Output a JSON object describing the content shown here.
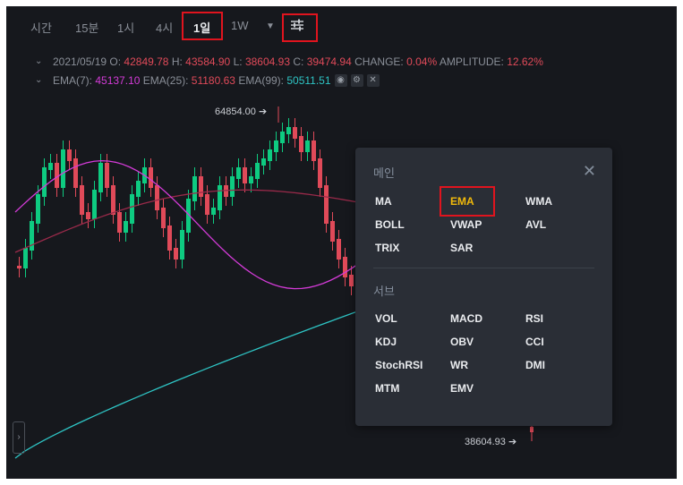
{
  "toolbar": {
    "items": [
      "시간",
      "15분",
      "1시",
      "4시",
      "1일",
      "1W"
    ],
    "active": "1일",
    "dropdown_icon": "caret-down-icon",
    "settings_icon": "sliders-icon"
  },
  "ohlc": {
    "date": "2021/05/19",
    "open_label": "O:",
    "open": "42849.78",
    "high_label": "H:",
    "high": "43584.90",
    "low_label": "L:",
    "low": "38604.93",
    "close_label": "C:",
    "close": "39474.94",
    "change_label": "CHANGE:",
    "change": "0.04%",
    "amplitude_label": "AMPLITUDE:",
    "amplitude": "12.62%"
  },
  "ema": {
    "ema7_label": "EMA(7):",
    "ema7": "45137.10",
    "ema25_label": "EMA(25):",
    "ema25": "51180.63",
    "ema99_label": "EMA(99):",
    "ema99": "50511.51"
  },
  "chart": {
    "high_marker": "64854.00",
    "low_marker": "38604.93"
  },
  "panel": {
    "main_title": "메인",
    "sub_title": "서브",
    "main_items": [
      "MA",
      "EMA",
      "WMA",
      "BOLL",
      "VWAP",
      "AVL",
      "TRIX",
      "SAR"
    ],
    "sub_items": [
      "VOL",
      "MACD",
      "RSI",
      "KDJ",
      "OBV",
      "CCI",
      "StochRSI",
      "WR",
      "DMI",
      "MTM",
      "EMV"
    ],
    "selected": "EMA"
  },
  "colors": {
    "up": "#0ecb81",
    "down": "#e04a59",
    "ema7": "#d43bd8",
    "ema25": "#9a2a4a",
    "ema99": "#2ec4c4",
    "accent": "#f0b90b",
    "highlight_box": "#e0141e"
  }
}
